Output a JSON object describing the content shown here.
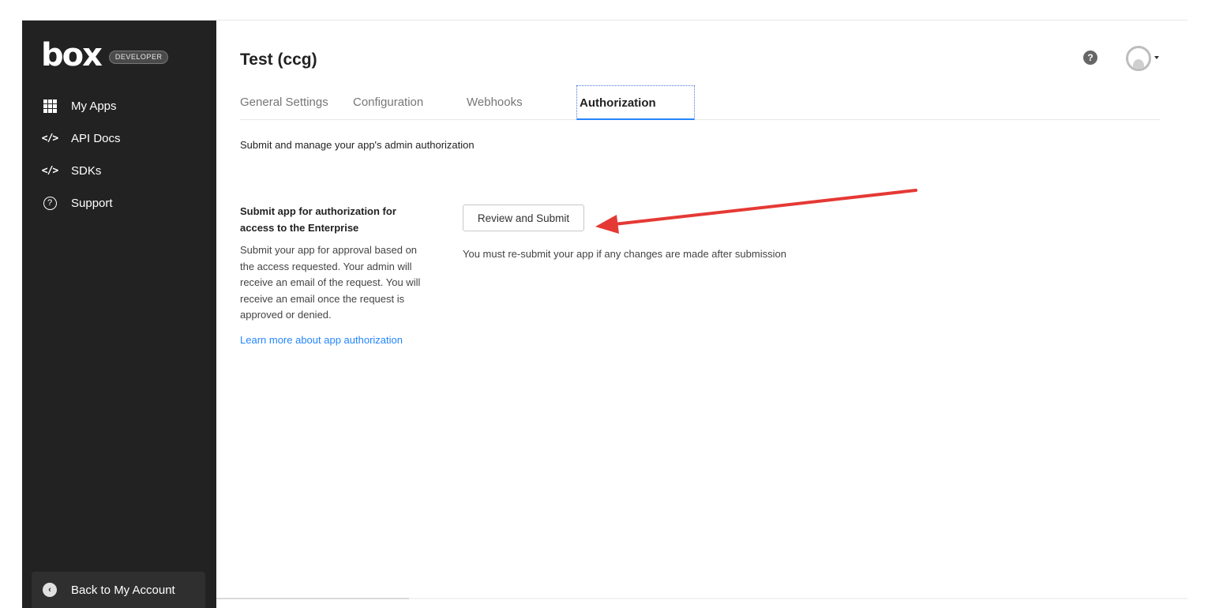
{
  "sidebar": {
    "logo": "box",
    "badge": "DEVELOPER",
    "items": [
      {
        "label": "My Apps",
        "icon": "grid-icon"
      },
      {
        "label": "API Docs",
        "icon": "code-icon",
        "glyph": "</>"
      },
      {
        "label": "SDKs",
        "icon": "code-icon",
        "glyph": "</>"
      },
      {
        "label": "Support",
        "icon": "question-circle-icon",
        "glyph": "?"
      }
    ],
    "back_label": "Back to My Account"
  },
  "header": {
    "title": "Test (ccg)",
    "help_glyph": "?"
  },
  "tabs": [
    {
      "label": "General Settings",
      "active": false
    },
    {
      "label": "Configuration",
      "active": false
    },
    {
      "label": "Webhooks",
      "active": false
    },
    {
      "label": "Authorization",
      "active": true
    }
  ],
  "content": {
    "subtitle": "Submit and manage your app's admin authorization",
    "section_title": "Submit app for authorization for access to the Enterprise",
    "section_desc": "Submit your app for approval based on the access requested. Your admin will receive an email of the request. You will receive an email once the request is approved or denied.",
    "learn_more": "Learn more about app authorization",
    "button_label": "Review and Submit",
    "note": "You must re-submit your app if any changes are made after submission"
  },
  "colors": {
    "sidebar_bg": "#222222",
    "accent": "#2486fc",
    "annotation_arrow": "#e53935"
  }
}
